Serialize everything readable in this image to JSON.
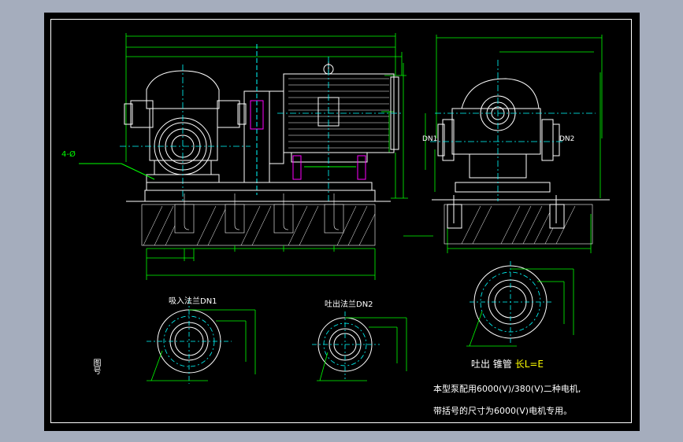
{
  "labels": {
    "hole": "4-Ø",
    "dn1": "DN1",
    "dn2": "DN2",
    "suction_flange": "吸入法兰DN1",
    "discharge_flange": "吐出法兰DN2",
    "outlet_label": "吐出",
    "outlet_suffix": "锥管",
    "outlet_len": "长L=E",
    "note_line1": "本型泵配用6000(V)/380(V)二种电机,",
    "note_line2": "带括号的尺寸为6000(V)电机专用。",
    "side_label": "图号"
  },
  "colors": {
    "line": "#ffffff",
    "dim": "#00ff00",
    "center": "#00ffff",
    "accent": "#ff00ff",
    "text_note": "#ffffff",
    "text_yellow": "#ffff00"
  }
}
